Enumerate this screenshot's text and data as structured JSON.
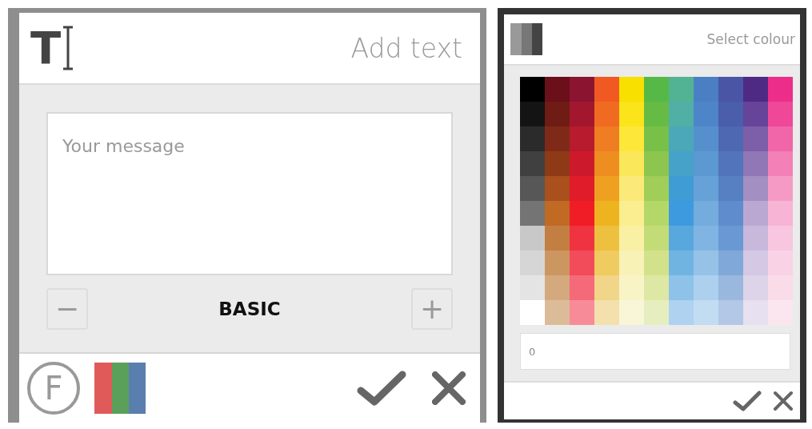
{
  "text_panel": {
    "tool_letter": "T",
    "title": "Add text",
    "message": {
      "placeholder": "Your message"
    },
    "style_label": "BASIC",
    "decrease_label": "−",
    "increase_label": "+",
    "font_button_label": "F"
  },
  "colour_panel": {
    "title": "Select colour",
    "value": "0",
    "palette": [
      {
        "swatches": [
          {
            "color": "#000000"
          },
          {
            "color": "#141414"
          },
          {
            "color": "#2b2b2b"
          },
          {
            "color": "#404040"
          },
          {
            "color": "#575757"
          },
          {
            "color": "#747474"
          },
          {
            "color": "#c8c8c8"
          },
          {
            "color": "#d6d6d6"
          },
          {
            "color": "#e4e4e4"
          },
          {
            "color": "#ffffff"
          }
        ]
      },
      {
        "swatches": [
          {
            "color": "#6b0f1a"
          },
          {
            "color": "#6e1c14"
          },
          {
            "color": "#7f2a18"
          },
          {
            "color": "#8e3a16"
          },
          {
            "color": "#a9501c"
          },
          {
            "color": "#c06a24"
          },
          {
            "color": "#c37e42"
          },
          {
            "color": "#cc9660"
          },
          {
            "color": "#d4a97e"
          },
          {
            "color": "#dcbc98"
          }
        ]
      },
      {
        "swatches": [
          {
            "color": "#8b1530"
          },
          {
            "color": "#a3172e"
          },
          {
            "color": "#b81a2e"
          },
          {
            "color": "#cc1a2c"
          },
          {
            "color": "#e01b2a"
          },
          {
            "color": "#f01d26"
          },
          {
            "color": "#ef3340"
          },
          {
            "color": "#f24b5a"
          },
          {
            "color": "#f46a78"
          },
          {
            "color": "#f78c98"
          }
        ]
      },
      {
        "swatches": [
          {
            "color": "#f05a22"
          },
          {
            "color": "#f16a22"
          },
          {
            "color": "#ef7d22"
          },
          {
            "color": "#ef8e20"
          },
          {
            "color": "#f0a020"
          },
          {
            "color": "#eeb420"
          },
          {
            "color": "#eec040"
          },
          {
            "color": "#efcb60"
          },
          {
            "color": "#f1d588"
          },
          {
            "color": "#f4e0ad"
          }
        ]
      },
      {
        "swatches": [
          {
            "color": "#f8e000"
          },
          {
            "color": "#fbe41a"
          },
          {
            "color": "#fde83a"
          },
          {
            "color": "#fbe75a"
          },
          {
            "color": "#fbea7a"
          },
          {
            "color": "#faee90"
          },
          {
            "color": "#f9f0a4"
          },
          {
            "color": "#f8f2b6"
          },
          {
            "color": "#f8f4c6"
          },
          {
            "color": "#f8f6d6"
          }
        ]
      },
      {
        "swatches": [
          {
            "color": "#56b947"
          },
          {
            "color": "#66bb44"
          },
          {
            "color": "#78c048"
          },
          {
            "color": "#8cc64e"
          },
          {
            "color": "#a0ce58"
          },
          {
            "color": "#b4d868"
          },
          {
            "color": "#c4dc78"
          },
          {
            "color": "#d2e28a"
          },
          {
            "color": "#dde8a4"
          },
          {
            "color": "#e6eec0"
          }
        ]
      },
      {
        "swatches": [
          {
            "color": "#52b394"
          },
          {
            "color": "#50b0a6"
          },
          {
            "color": "#4aa8b8"
          },
          {
            "color": "#46a2c8"
          },
          {
            "color": "#409cd4"
          },
          {
            "color": "#3e9ade"
          },
          {
            "color": "#58a8de"
          },
          {
            "color": "#70b4e2"
          },
          {
            "color": "#8ec2e8"
          },
          {
            "color": "#aed2ef"
          }
        ]
      },
      {
        "swatches": [
          {
            "color": "#4a7fc4"
          },
          {
            "color": "#4d85c8"
          },
          {
            "color": "#5590cd"
          },
          {
            "color": "#5c98d2"
          },
          {
            "color": "#66a2d8"
          },
          {
            "color": "#74acde"
          },
          {
            "color": "#80b4e2"
          },
          {
            "color": "#96c2e8"
          },
          {
            "color": "#acd0ee"
          },
          {
            "color": "#c2dcf2"
          }
        ]
      },
      {
        "swatches": [
          {
            "color": "#4a55a6"
          },
          {
            "color": "#4a5eab"
          },
          {
            "color": "#4e68b2"
          },
          {
            "color": "#5274ba"
          },
          {
            "color": "#5680c2"
          },
          {
            "color": "#5e8ccc"
          },
          {
            "color": "#6a98d2"
          },
          {
            "color": "#80a8d8"
          },
          {
            "color": "#9ab8de"
          },
          {
            "color": "#b2c8e6"
          }
        ]
      },
      {
        "swatches": [
          {
            "color": "#4f2a84"
          },
          {
            "color": "#65449a"
          },
          {
            "color": "#7c5fa8"
          },
          {
            "color": "#9078b6"
          },
          {
            "color": "#a48fc2"
          },
          {
            "color": "#bba8d2"
          },
          {
            "color": "#c8b8dc"
          },
          {
            "color": "#d4c8e4"
          },
          {
            "color": "#ddd4ea"
          },
          {
            "color": "#e6e0f0"
          }
        ]
      },
      {
        "swatches": [
          {
            "color": "#ec2d8a"
          },
          {
            "color": "#ef4898"
          },
          {
            "color": "#f166a8"
          },
          {
            "color": "#f380b6"
          },
          {
            "color": "#f59ac4"
          },
          {
            "color": "#f7b4d4"
          },
          {
            "color": "#f8c6de"
          },
          {
            "color": "#f9d2e6"
          },
          {
            "color": "#fadce8"
          },
          {
            "color": "#fbe6ef"
          }
        ]
      }
    ]
  }
}
